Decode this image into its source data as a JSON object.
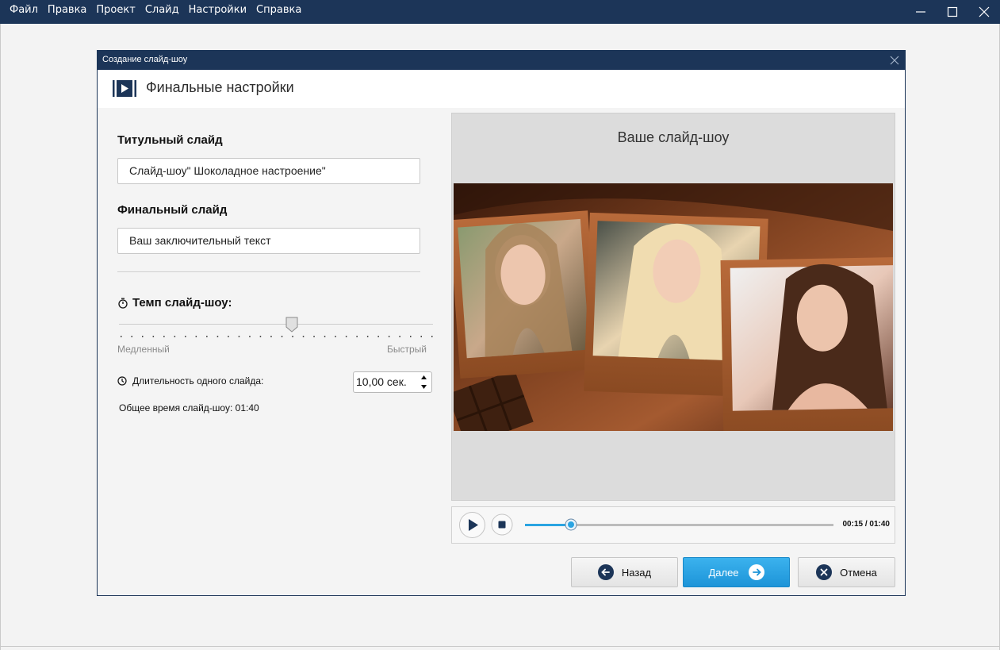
{
  "menubar": {
    "items": [
      {
        "label": "Файл"
      },
      {
        "label": "Правка"
      },
      {
        "label": "Проект"
      },
      {
        "label": "Слайд"
      },
      {
        "label": "Настройки"
      },
      {
        "label": "Справка"
      }
    ],
    "background": "#1c3558"
  },
  "window_controls": [
    "minimize-icon",
    "maximize-icon",
    "close-icon"
  ],
  "dialog": {
    "title": "Создание слайд-шоу",
    "header_icon": "slideshow-play-icon",
    "header_title": "Финальные настройки"
  },
  "settings": {
    "title_slide_label": "Титульный слайд",
    "title_slide_value": "Слайд-шоу\" Шоколадное настроение\"",
    "final_slide_label": "Финальный слайд",
    "final_slide_value": "Ваш заключительный текст",
    "tempo_label": "Темп слайд-шоу:",
    "tempo_icon": "stopwatch-icon",
    "tempo_level": 0.55,
    "tempo_min_label": "Медленный",
    "tempo_max_label": "Быстрый",
    "duration_label": "Длительность одного слайда:",
    "duration_icon": "clock-icon",
    "duration_value": "10,00 сек.",
    "total_time": "Общее время слайд-шоу: 01:40"
  },
  "preview": {
    "title": "Ваше слайд-шоу",
    "image_description_icon": "chocolate-collage-preview",
    "progress": 0.15,
    "time_readout": "00:15 / 01:40"
  },
  "buttons": {
    "back_label": "Назад",
    "next_label": "Далее",
    "cancel_label": "Отмена"
  },
  "colors": {
    "accent": "#1c3558",
    "primary_button": "#2aa4e2",
    "seek_fill": "#2aa4e2"
  }
}
